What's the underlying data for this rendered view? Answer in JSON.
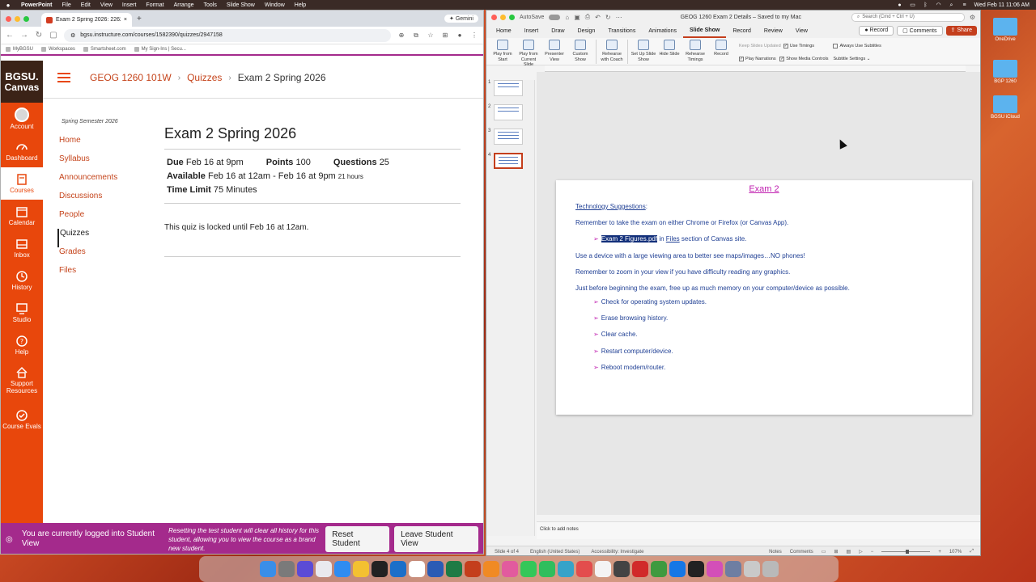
{
  "menubar": {
    "apple": "",
    "items": [
      "PowerPoint",
      "File",
      "Edit",
      "View",
      "Insert",
      "Format",
      "Arrange",
      "Tools",
      "Slide Show",
      "Window",
      "Help"
    ],
    "datetime": "Wed Feb 11  11:06 AM"
  },
  "browser": {
    "tab_title": "Exam 2 Spring 2026: 2262 G",
    "new_tab": "+",
    "gemini": "Gemini",
    "url": "bgsu.instructure.com/courses/1582390/quizzes/2947158",
    "bookmarks": [
      "MyBGSU",
      "Workspaces",
      "Smartsheet.com",
      "My Sign-Ins | Secu..."
    ]
  },
  "canvas": {
    "logo_line1": "BGSU.",
    "logo_line2": "Canvas",
    "global_nav": [
      "Account",
      "Dashboard",
      "Courses",
      "Calendar",
      "Inbox",
      "History",
      "Studio",
      "Help",
      "Support Resources",
      "Course Evals"
    ],
    "breadcrumb": {
      "course": "GEOG 1260 101W",
      "section": "Quizzes",
      "current": "Exam 2 Spring 2026",
      "sep": "›"
    },
    "term": "Spring Semester 2026",
    "course_nav": [
      "Home",
      "Syllabus",
      "Announcements",
      "Discussions",
      "People",
      "Quizzes",
      "Grades",
      "Files"
    ],
    "quiz": {
      "title": "Exam 2 Spring 2026",
      "due_label": "Due",
      "due": "Feb 16 at 9pm",
      "points_label": "Points",
      "points": "100",
      "questions_label": "Questions",
      "questions": "25",
      "available_label": "Available",
      "available": "Feb 16 at 12am - Feb 16 at 9pm",
      "available_hours": "21 hours",
      "time_limit_label": "Time Limit",
      "time_limit": "75 Minutes",
      "locked_msg": "This quiz is locked until Feb 16 at 12am."
    },
    "student_view": {
      "msg": "You are currently logged into Student View",
      "note": "Resetting the test student will clear all history for this student, allowing you to view the course as a brand new student.",
      "reset": "Reset Student",
      "leave": "Leave Student View"
    }
  },
  "ppt": {
    "autosave": "AutoSave",
    "doc_title": "GEOG 1260 Exam 2 Details – Saved to my Mac",
    "search": "Search (Cmd + Ctrl + U)",
    "tabs": [
      "Home",
      "Insert",
      "Draw",
      "Design",
      "Transitions",
      "Animations",
      "Slide Show",
      "Record",
      "Review",
      "View"
    ],
    "record_btn": "Record",
    "comments_btn": "Comments",
    "share_btn": "Share",
    "ribbon": [
      "Play from Start",
      "Play from Current Slide",
      "Presenter View",
      "Custom Show",
      "Rehearse with Coach",
      "Set Up Slide Show",
      "Hide Slide",
      "Rehearse Timings",
      "Record"
    ],
    "ribbon_opts": {
      "keep_updated": "Keep Slides Updated",
      "use_timings": "Use Timings",
      "play_narrations": "Play Narrations",
      "show_media": "Show Media Controls",
      "always_subtitles": "Always Use Subtitles",
      "subtitle_settings": "Subtitle Settings"
    },
    "thumb_numbers": [
      "1",
      "2",
      "3",
      "4"
    ],
    "slide": {
      "title": "Exam 2",
      "tech": "Technology Suggestions",
      "tech_colon": ":",
      "l1": "Remember to take the exam on either Chrome or Firefox (or Canvas App).",
      "l2_file": "Exam 2 Figures.pdf",
      "l2_in": "in",
      "l2_files": "Files",
      "l2_rest": "section of Canvas site.",
      "l3": "Use a device with a large viewing area to better see maps/images…NO phones!",
      "l4": "Remember to zoom in your view if you have difficulty reading any graphics.",
      "l5": "Just before beginning the exam, free up as much memory on your computer/device as possible.",
      "bullets": [
        "Check for operating system updates.",
        "Erase browsing history.",
        "Clear cache.",
        "Restart computer/device.",
        "Reboot modem/router."
      ]
    },
    "notes_placeholder": "Click to add notes",
    "status": {
      "slide": "Slide 4 of 4",
      "lang": "English (United States)",
      "accessibility": "Accessibility: Investigate",
      "notes": "Notes",
      "comments": "Comments",
      "zoom": "107%"
    }
  },
  "desktop": {
    "icons": [
      "OneDrive",
      "BGP 1260",
      "BGSU iCloud"
    ]
  }
}
